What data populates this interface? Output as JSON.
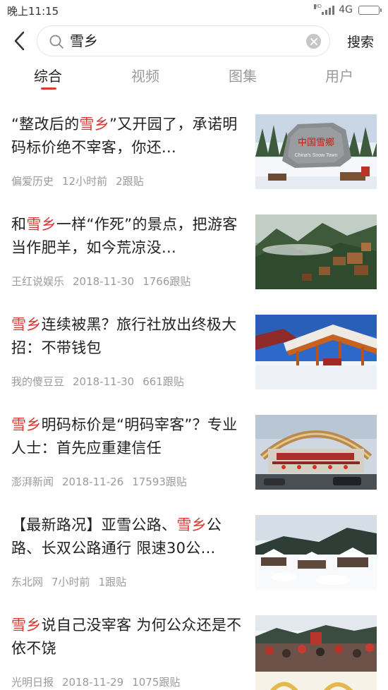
{
  "status_bar": {
    "time": "晚上11:15",
    "network": "4G",
    "hd": "HD"
  },
  "search": {
    "query": "雪乡",
    "button_label": "搜索"
  },
  "tabs": [
    "综合",
    "视频",
    "图集",
    "用户"
  ],
  "active_tab": "综合",
  "colors": {
    "accent": "#d43c33",
    "meta": "#9b9b9b"
  },
  "articles": [
    {
      "title_before": "“整改后的",
      "title_highlight": "雪乡",
      "title_after": "”又开园了，承诺明码标价绝不宰客，你还...",
      "source": "偏爱历史",
      "time": "12小时前",
      "comments": "2跟贴"
    },
    {
      "title_before": "和",
      "title_highlight": "雪乡",
      "title_after": "一样“作死”的景点，把游客当作肥羊，如今荒凉没...",
      "source": "王红说娱乐",
      "time": "2018-11-30",
      "comments": "1766跟贴"
    },
    {
      "title_before": "",
      "title_highlight": "雪乡",
      "title_after": "连续被黑？旅行社放出终极大招：不带钱包",
      "source": "我的傻豆豆",
      "time": "2018-11-30",
      "comments": "661跟贴"
    },
    {
      "title_before": "",
      "title_highlight": "雪乡",
      "title_after": "明码标价是“明码宰客”？专业人士：首先应重建信任",
      "source": "澎湃新闻",
      "time": "2018-11-26",
      "comments": "17593跟贴"
    },
    {
      "title_before": "【最新路况】亚雪公路、",
      "title_highlight": "雪乡",
      "title_after": "公路、长双公路通行 限速30公...",
      "source": "东北网",
      "time": "7小时前",
      "comments": "1跟贴"
    },
    {
      "title_before": "",
      "title_highlight": "雪乡",
      "title_after": "说自己没宰客 为何公众还是不依不饶",
      "source": "光明日报",
      "time": "2018-11-29",
      "comments": "1075跟贴"
    }
  ],
  "thumb_texts": {
    "thumb1_sign": "中国雪鄉",
    "thumb1_sign_sub": "China's Snow Town"
  }
}
